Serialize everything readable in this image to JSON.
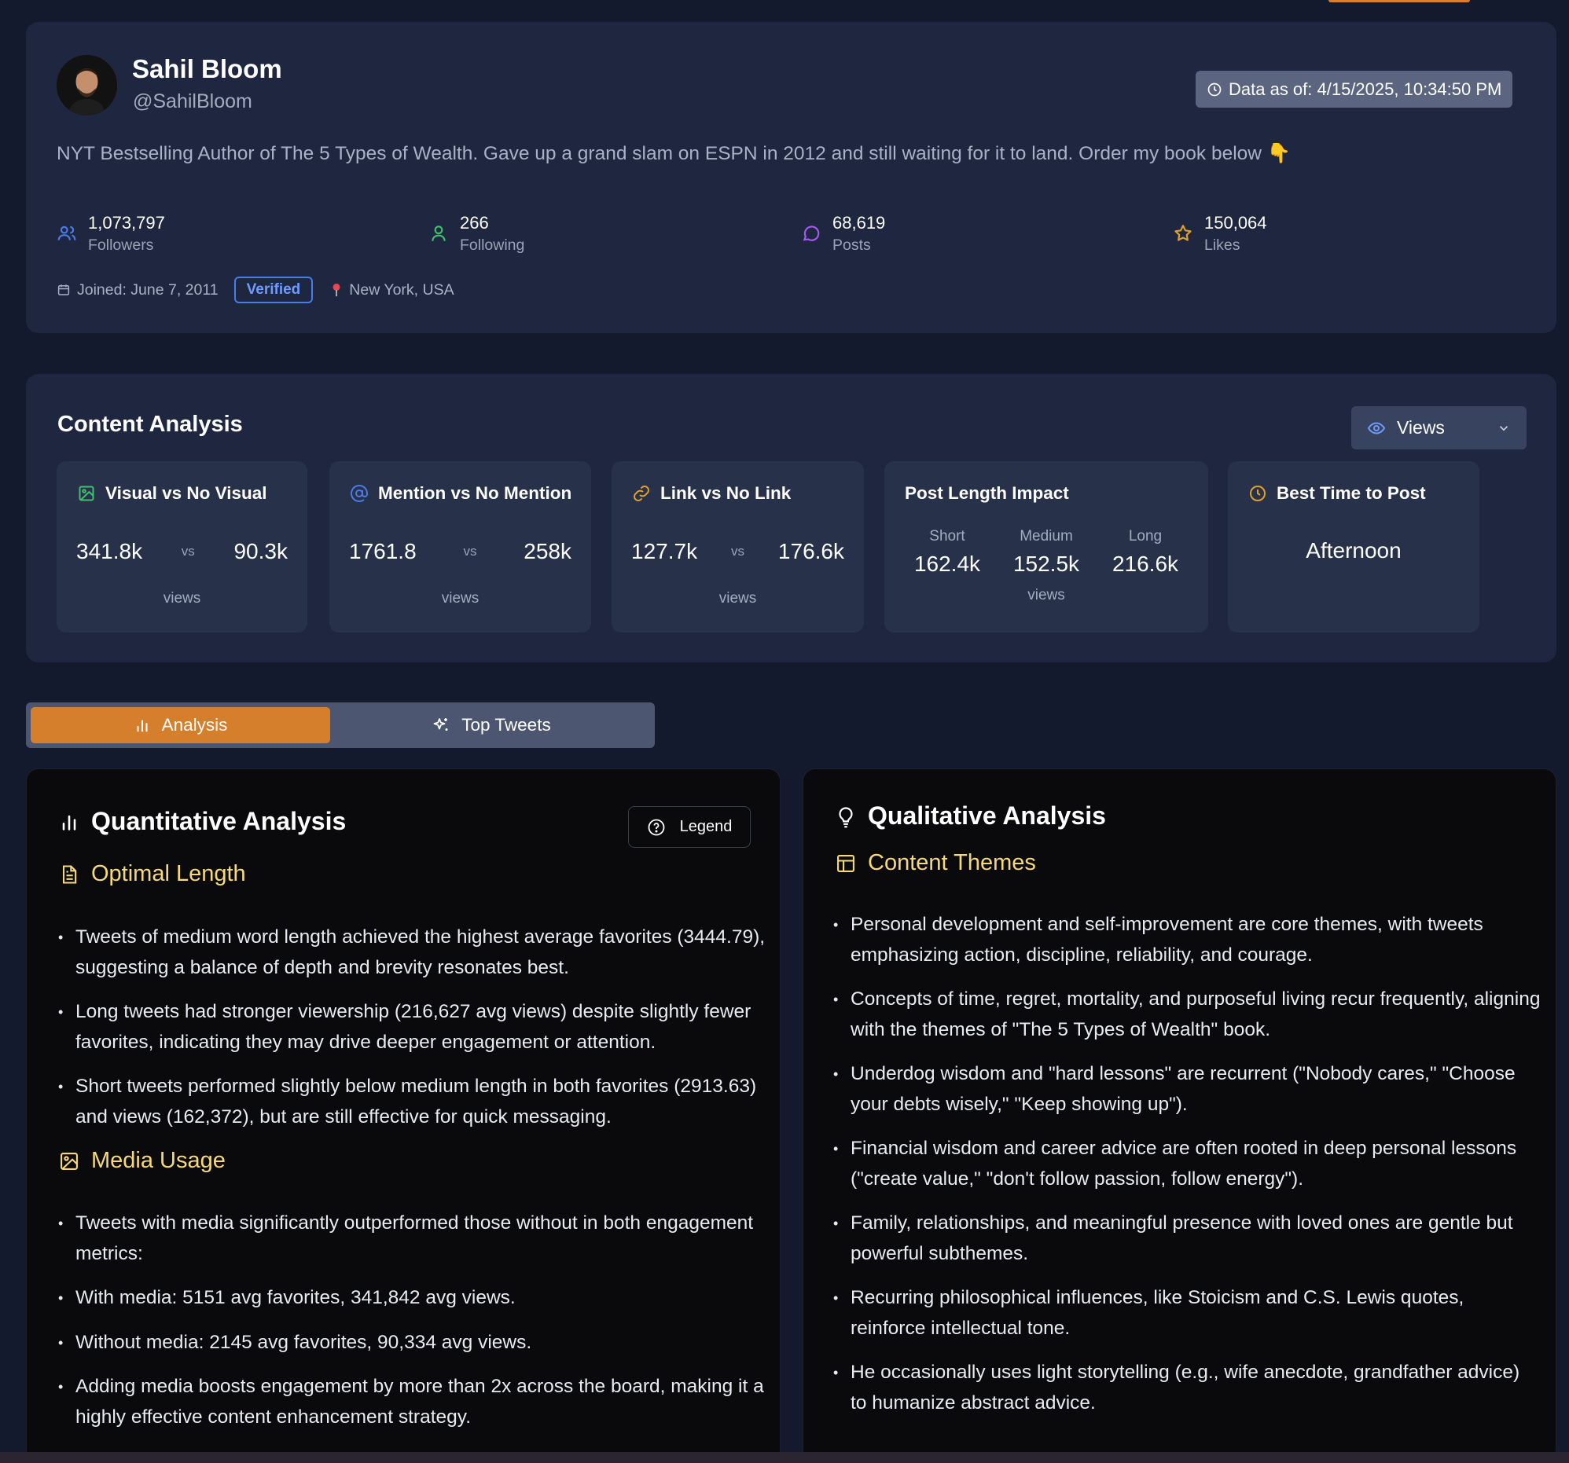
{
  "profile": {
    "name": "Sahil Bloom",
    "handle": "@SahilBloom",
    "data_as_of": "Data as of: 4/15/2025, 10:34:50 PM",
    "bio": "NYT Bestselling Author of The 5 Types of Wealth. Gave up a grand slam on ESPN in 2012 and still waiting for it to land. Order my book below 👇",
    "stats": [
      {
        "value": "1,073,797",
        "label": "Followers",
        "icon": "users-icon",
        "color": "#4a7be8"
      },
      {
        "value": "266",
        "label": "Following",
        "icon": "user-icon",
        "color": "#3fbf6f"
      },
      {
        "value": "68,619",
        "label": "Posts",
        "icon": "chat-bubble-icon",
        "color": "#a25bf0"
      },
      {
        "value": "150,064",
        "label": "Likes",
        "icon": "star-icon",
        "color": "#e0a12b"
      }
    ],
    "joined": "Joined: June 7, 2011",
    "verified": "Verified",
    "location": "New York, USA"
  },
  "content_analysis": {
    "title": "Content Analysis",
    "metric_select": "Views",
    "cards": [
      {
        "title": "Visual vs No Visual",
        "a": "341.8k",
        "vs": "vs",
        "b": "90.3k",
        "unit": "views",
        "icon": "image-icon"
      },
      {
        "title": "Mention vs No Mention",
        "a": "1761.8",
        "vs": "vs",
        "b": "258k",
        "unit": "views",
        "icon": "at-sign-icon"
      },
      {
        "title": "Link vs No Link",
        "a": "127.7k",
        "vs": "vs",
        "b": "176.6k",
        "unit": "views",
        "icon": "link-icon"
      }
    ],
    "post_length": {
      "title": "Post Length Impact",
      "columns": [
        {
          "label": "Short",
          "value": "162.4k"
        },
        {
          "label": "Medium",
          "value": "152.5k"
        },
        {
          "label": "Long",
          "value": "216.6k"
        }
      ],
      "unit": "views"
    },
    "best_time": {
      "title": "Best Time to Post",
      "value": "Afternoon",
      "icon": "clock-icon"
    }
  },
  "tabs": {
    "analysis": "Analysis",
    "top_tweets": "Top Tweets"
  },
  "quantitative": {
    "title": "Quantitative Analysis",
    "legend": "Legend",
    "sections": [
      {
        "heading": "Optimal Length",
        "icon": "document-icon",
        "bullets": [
          "Tweets of medium word length achieved the highest average favorites (3444.79), suggesting a balance of depth and brevity resonates best.",
          "Long tweets had stronger viewership (216,627 avg views) despite slightly fewer favorites, indicating they may drive deeper engagement or attention.",
          "Short tweets performed slightly below medium length in both favorites (2913.63) and views (162,372), but are still effective for quick messaging."
        ]
      },
      {
        "heading": "Media Usage",
        "icon": "image-icon",
        "bullets": [
          "Tweets with media significantly outperformed those without in both engagement metrics:",
          "With media: 5151 avg favorites, 341,842 avg views.",
          "Without media: 2145 avg favorites, 90,334 avg views.",
          "Adding media boosts engagement by more than 2x across the board, making it a highly effective content enhancement strategy."
        ]
      }
    ]
  },
  "qualitative": {
    "title": "Qualitative Analysis",
    "sections": [
      {
        "heading": "Content Themes",
        "icon": "layout-icon",
        "bullets": [
          "Personal development and self-improvement are core themes, with tweets emphasizing action, discipline, reliability, and courage.",
          "Concepts of time, regret, mortality, and purposeful living recur frequently, aligning with the themes of \"The 5 Types of Wealth\" book.",
          "Underdog wisdom and \"hard lessons\" are recurrent (\"Nobody cares,\" \"Choose your debts wisely,\" \"Keep showing up\").",
          "Financial wisdom and career advice are often rooted in deep personal lessons (\"create value,\" \"don't follow passion, follow energy\").",
          "Family, relationships, and meaningful presence with loved ones are gentle but powerful subthemes.",
          "Recurring philosophical influences, like Stoicism and C.S. Lewis quotes, reinforce intellectual tone.",
          "He occasionally uses light storytelling (e.g., wife anecdote, grandfather advice) to humanize abstract advice."
        ]
      }
    ]
  },
  "colors": {
    "accent": "#d57f2c",
    "section_heading": "#f6d97a",
    "verified": "#4a7be8"
  }
}
